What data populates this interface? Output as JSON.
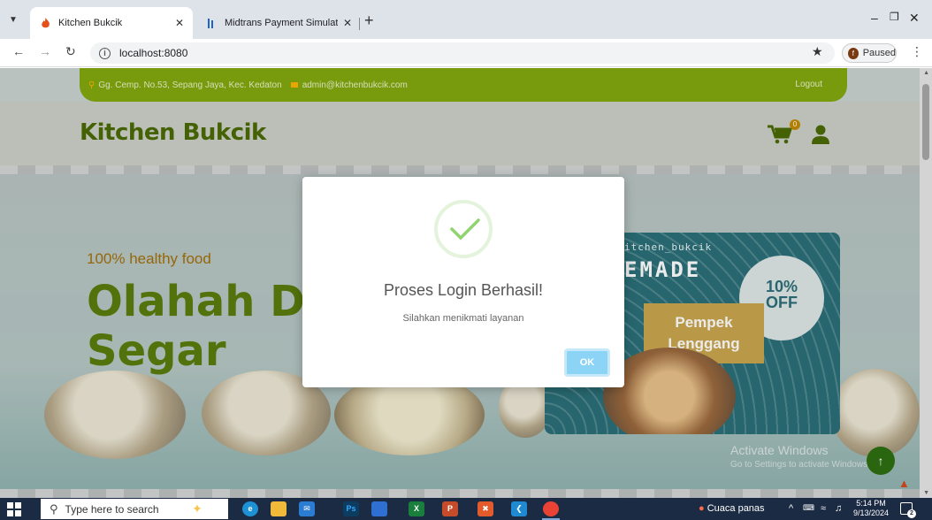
{
  "browser": {
    "tabs": [
      {
        "title": "Kitchen Bukcik",
        "active": true
      },
      {
        "title": "Midtrans Payment Simulator",
        "active": false
      }
    ],
    "new_tab": "+",
    "url": "localhost:8080",
    "profile_status": "Paused",
    "profile_initial": "f"
  },
  "site": {
    "address": "Gg. Cemp. No.53, Sepang Jaya, Kec. Kedaton",
    "email": "admin@kitchenbukcik.com",
    "logout": "Logout",
    "brand": "Kitchen Bukcik",
    "cart_count": "0",
    "hero": {
      "tagline": "100% healthy food",
      "title_line1": "Olahah Da",
      "title_line2": "Segar"
    },
    "promo": {
      "handle": "itchen_bukcik",
      "headline": "EMADE",
      "discount_line1": "10%",
      "discount_line2": "OFF",
      "product_line1": "Pempek",
      "product_line2": "Lenggang"
    }
  },
  "modal": {
    "title": "Proses Login Berhasil!",
    "message": "Silahkan menikmati layanan",
    "ok": "OK"
  },
  "os": {
    "watermark_title": "Activate Windows",
    "watermark_sub": "Go to Settings to activate Windows.",
    "search_placeholder": "Type here to search",
    "weather": "Cuaca panas",
    "time": "5:14 PM",
    "date": "9/13/2024",
    "notification_count": "2"
  },
  "colors": {
    "brand_green": "#82a90e",
    "brand_dark_green": "#4a6b05",
    "accent_orange": "#a2700a",
    "ok_button": "#8cd4f5",
    "success_check": "#76c95a"
  }
}
